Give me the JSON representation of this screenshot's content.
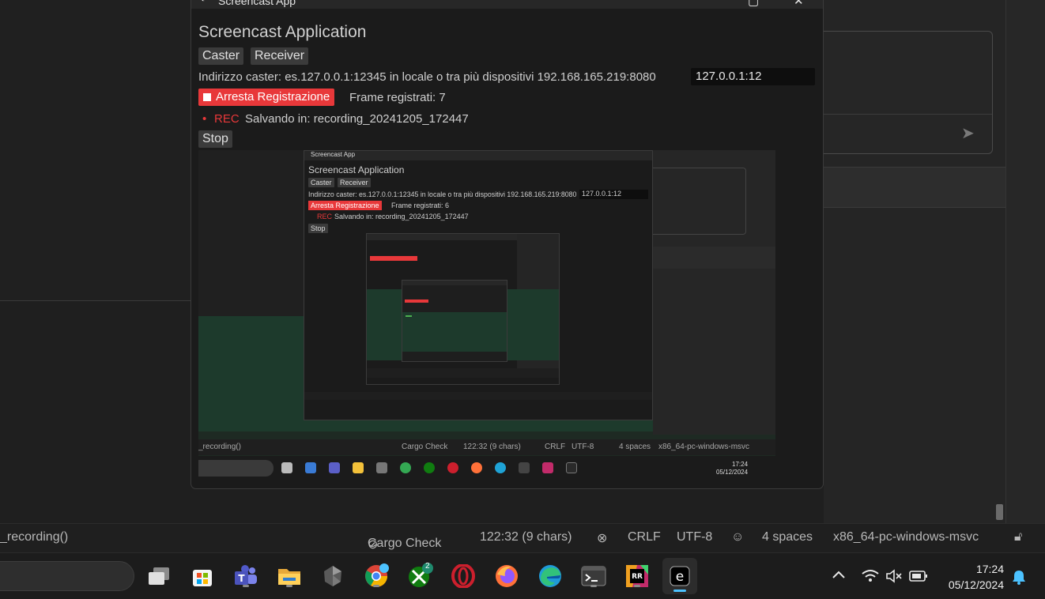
{
  "window": {
    "title": "Screencast App",
    "app_heading": "Screencast Application",
    "tabs": [
      "Caster",
      "Receiver"
    ],
    "address_label": "Indirizzo caster: es.127.0.0.1:12345 in locale o tra più dispositivi 192.168.165.219:8080",
    "address_value": "127.0.0.1:12",
    "record_button": "Arresta Registrazione",
    "frames_text": "Frame registrati: 7",
    "rec_label": "REC",
    "saving_text": "Salvando in: recording_20241205_172447",
    "stop_button": "Stop"
  },
  "preview": {
    "nested_window": {
      "title": "Screencast App",
      "app_heading": "Screencast Application",
      "tabs": [
        "Caster",
        "Receiver"
      ],
      "address_label": "Indirizzo caster: es.127.0.0.1:12345 in locale o tra più dispositivi 192.168.165.219:8080",
      "address_value": "127.0.0.1:12",
      "record_button": "Arresta Registrazione",
      "frames_text": "Frame registrati: 6",
      "rec_label": "REC",
      "saving_text": "Salvando in: recording_20241205_172447",
      "stop_button": "Stop"
    },
    "status": {
      "fn": "_recording()",
      "cargo": "Cargo Check",
      "pos": "122:32 (9 chars)",
      "eol": "CRLF",
      "enc": "UTF-8",
      "indent": "4 spaces",
      "target": "x86_64-pc-windows-msvc"
    },
    "clock_time": "17:24",
    "clock_date": "05/12/2024"
  },
  "statusbar": {
    "fn": "_recording()",
    "cargo": "Cargo Check",
    "pos": "122:32 (9 chars)",
    "eol": "CRLF",
    "enc": "UTF-8",
    "indent": "4 spaces",
    "target": "x86_64-pc-windows-msvc"
  },
  "taskbar": {
    "apps": [
      "task-view-icon",
      "store-icon",
      "teams-icon",
      "file-explorer-icon",
      "obsidian-icon",
      "chrome-icon",
      "xbox-icon",
      "opera-icon",
      "firefox-icon",
      "edge-icon",
      "terminal-icon",
      "rustrover-icon",
      "screencast-app-icon"
    ],
    "xbox_badge": "2",
    "clock_time": "17:24",
    "clock_date": "05/12/2024"
  },
  "colors": {
    "record_red": "#e8383a",
    "accent_blue": "#4cc2ff",
    "preview_green": "#1d3a2c"
  }
}
